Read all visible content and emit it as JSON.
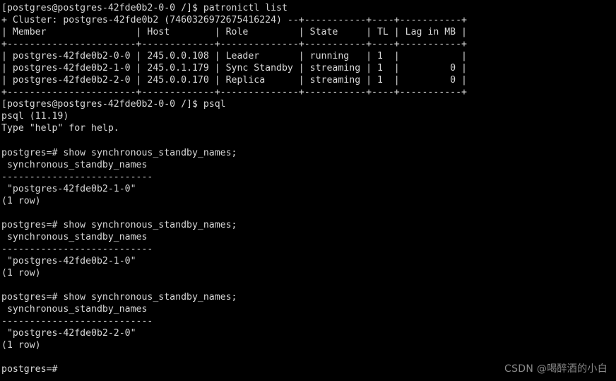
{
  "terminal": {
    "background_color": "#000000",
    "foreground_color": "#d8d8d8",
    "lines": [
      "[postgres@postgres-42fde0b2-0-0 /]$ patronictl list",
      "+ Cluster: postgres-42fde0b2 (7460326972675416224) --+-----------+----+-----------+",
      "| Member                | Host        | Role         | State     | TL | Lag in MB |",
      "+-----------------------+-------------+--------------+-----------+----+-----------+",
      "| postgres-42fde0b2-0-0 | 245.0.0.108 | Leader       | running   | 1  |           |",
      "| postgres-42fde0b2-1-0 | 245.0.1.179 | Sync Standby | streaming | 1  |         0 |",
      "| postgres-42fde0b2-2-0 | 245.0.0.170 | Replica      | streaming | 1  |         0 |",
      "+-----------------------+-------------+--------------+-----------+----+-----------+",
      "[postgres@postgres-42fde0b2-0-0 /]$ psql",
      "psql (11.19)",
      "Type \"help\" for help.",
      "",
      "postgres=# show synchronous_standby_names;",
      " synchronous_standby_names",
      "---------------------------",
      " \"postgres-42fde0b2-1-0\"",
      "(1 row)",
      "",
      "postgres=# show synchronous_standby_names;",
      " synchronous_standby_names",
      "---------------------------",
      " \"postgres-42fde0b2-1-0\"",
      "(1 row)",
      "",
      "postgres=# show synchronous_standby_names;",
      " synchronous_standby_names",
      "---------------------------",
      " \"postgres-42fde0b2-2-0\"",
      "(1 row)",
      "",
      "postgres=#"
    ]
  },
  "shell": {
    "prompt": "[postgres@postgres-42fde0b2-0-0 /]$",
    "user": "postgres",
    "host": "postgres-42fde0b2-0-0",
    "cwd": "/",
    "commands": [
      "patronictl list",
      "psql"
    ]
  },
  "patroni": {
    "cluster_label": "+ Cluster: postgres-42fde0b2 (7460326972675416224) --+",
    "cluster_name": "postgres-42fde0b2",
    "cluster_id": "7460326972675416224",
    "columns": [
      "Member",
      "Host",
      "Role",
      "State",
      "TL",
      "Lag in MB"
    ],
    "rows": [
      {
        "member": "postgres-42fde0b2-0-0",
        "host": "245.0.0.108",
        "role": "Leader",
        "state": "running",
        "tl": "1",
        "lag_in_mb": ""
      },
      {
        "member": "postgres-42fde0b2-1-0",
        "host": "245.0.1.179",
        "role": "Sync Standby",
        "state": "streaming",
        "tl": "1",
        "lag_in_mb": "0"
      },
      {
        "member": "postgres-42fde0b2-2-0",
        "host": "245.0.0.170",
        "role": "Replica",
        "state": "streaming",
        "tl": "1",
        "lag_in_mb": "0"
      }
    ]
  },
  "psql": {
    "version_banner": "psql (11.19)",
    "help_banner": "Type \"help\" for help.",
    "prompt": "postgres=#",
    "query": "show synchronous_standby_names;",
    "result_column": "synchronous_standby_names",
    "separator": "---------------------------",
    "row_count_label": "(1 row)",
    "results": [
      "\"postgres-42fde0b2-1-0\"",
      "\"postgres-42fde0b2-1-0\"",
      "\"postgres-42fde0b2-2-0\""
    ]
  },
  "watermark": {
    "text": "CSDN @喝醉酒的小白",
    "color": "#8a8a8a"
  }
}
